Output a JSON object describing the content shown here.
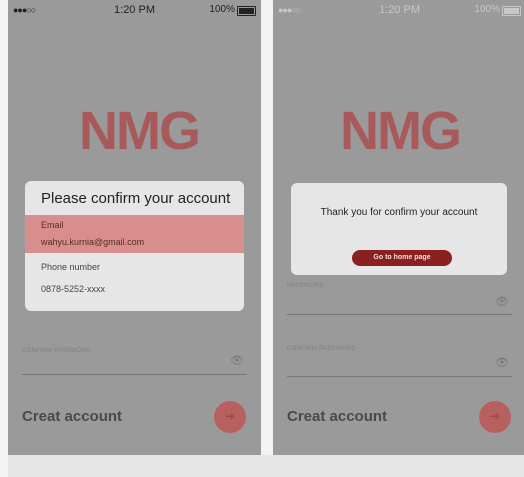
{
  "status_bar": {
    "signal": "●●●○○",
    "time": "1:20 PM",
    "battery": "100%"
  },
  "brand": {
    "logo_text": "NMG",
    "logo_colors": {
      "left": "#a85a5a",
      "right": "#7a7a7a"
    }
  },
  "form": {
    "password_label": "PASSWORD",
    "confirm_password_label": "CONFIRM PASSWORD",
    "create_account_label": "Creat account"
  },
  "confirm_dialog": {
    "title": "Please confirm your account",
    "email_label": "Email",
    "email_value": "wahyu.kurnia@gmail.com",
    "phone_label": "Phone number",
    "phone_value": "0878-5252-xxxx"
  },
  "success_dialog": {
    "message": "Thank you for confirm your account",
    "button_label": "Go to home page"
  },
  "icons": {
    "eye": "eye-icon",
    "fab": "arrow-right-icon"
  },
  "colors": {
    "accent": "#8b2020",
    "highlight": "#d98e8e",
    "overlay": "#9a9a9a"
  }
}
